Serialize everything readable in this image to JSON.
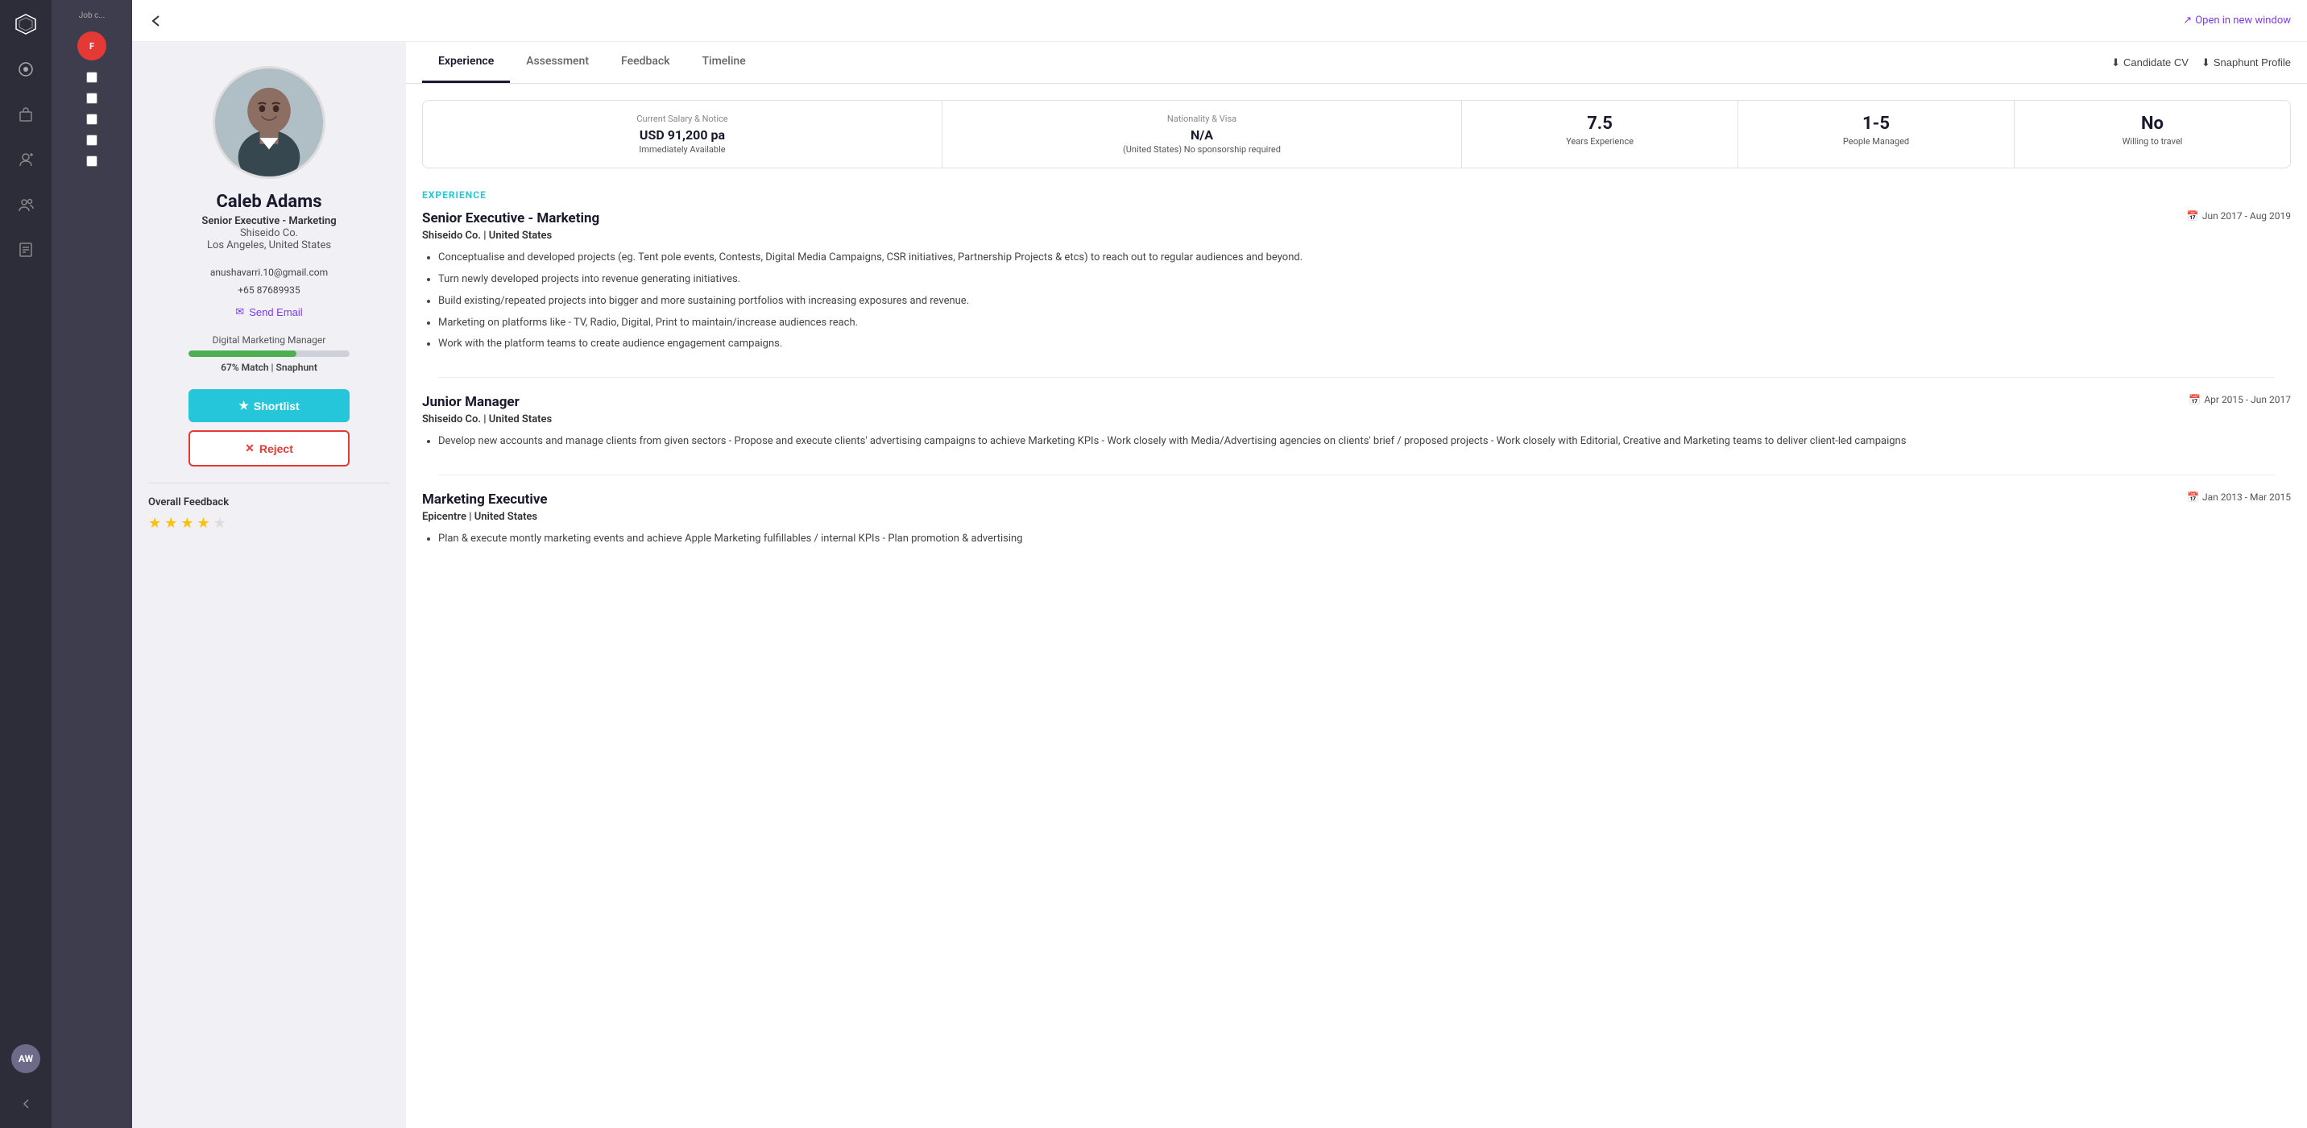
{
  "sidebar": {
    "logo": "✦",
    "icons": [
      "☺",
      "💼",
      "👤",
      "👥",
      "📋"
    ],
    "avatar_initials": "AW",
    "back_arrow": "←"
  },
  "top_nav": {
    "back_label": "←",
    "open_new_window_label": "Open in new window",
    "open_icon": "↗"
  },
  "tabs": [
    {
      "label": "Experience",
      "active": true
    },
    {
      "label": "Assessment",
      "active": false
    },
    {
      "label": "Feedback",
      "active": false
    },
    {
      "label": "Timeline",
      "active": false
    }
  ],
  "tab_actions": [
    {
      "label": "Candidate CV",
      "icon": "⬇"
    },
    {
      "label": "Snaphunt Profile",
      "icon": "⬇"
    }
  ],
  "stats": [
    {
      "label": "Current Salary & Notice",
      "value": "USD 91,200 pa",
      "sub": "Immediately Available",
      "wide": true
    },
    {
      "label": "Nationality & Visa",
      "value": "N/A",
      "sub": "(United States) No sponsorship required",
      "wide": true
    },
    {
      "label": "Years Experience",
      "value": "7.5",
      "sub": "Years Experience",
      "wide": false
    },
    {
      "label": "People Managed",
      "value": "1-5",
      "sub": "People Managed",
      "wide": false
    },
    {
      "label": "Willing to travel",
      "value": "No",
      "sub": "Willing to travel",
      "wide": false
    }
  ],
  "profile": {
    "name": "Caleb Adams",
    "title": "Senior Executive - Marketing",
    "company": "Shiseido Co.",
    "location": "Los Angeles, United States",
    "email": "anushavarri.10@gmail.com",
    "phone": "+65 87689935",
    "send_email_label": "Send Email",
    "match_for": "Digital Marketing Manager",
    "match_percent": 67,
    "match_text": "67% Match | Snaphunt",
    "shortlist_label": "Shortlist",
    "reject_label": "Reject",
    "overall_feedback_label": "Overall Feedback",
    "stars": [
      true,
      true,
      true,
      true,
      false
    ]
  },
  "experience_section": {
    "tag": "EXPERIENCE",
    "items": [
      {
        "title": "Senior Executive - Marketing",
        "company": "Shiseido Co. | United States",
        "date": "Jun 2017 - Aug 2019",
        "bullets": [
          "Conceptualise and developed projects (eg. Tent pole events, Contests, Digital Media Campaigns, CSR initiatives, Partnership Projects & etcs) to reach out to regular audiences and beyond.",
          "Turn newly developed projects into revenue generating initiatives.",
          "Build existing/repeated projects into bigger and more sustaining portfolios with increasing exposures and revenue.",
          "Marketing on platforms like - TV, Radio, Digital, Print to maintain/increase audiences reach.",
          "Work with the platform teams to create audience engagement campaigns."
        ]
      },
      {
        "title": "Junior Manager",
        "company": "Shiseido Co. | United States",
        "date": "Apr 2015 - Jun 2017",
        "bullets": [
          "Develop new accounts and manage clients from given sectors - Propose and execute clients' advertising campaigns to achieve Marketing KPIs - Work closely with Media/Advertising agencies on clients' brief / proposed projects - Work closely with Editorial, Creative and Marketing teams to deliver client-led campaigns"
        ]
      },
      {
        "title": "Marketing Executive",
        "company": "Epicentre | United States",
        "date": "Jan 2013 - Mar 2015",
        "bullets": [
          "Plan & execute montly marketing events and achieve Apple Marketing fulfillables / internal KPIs - Plan promotion & advertising"
        ]
      }
    ]
  }
}
